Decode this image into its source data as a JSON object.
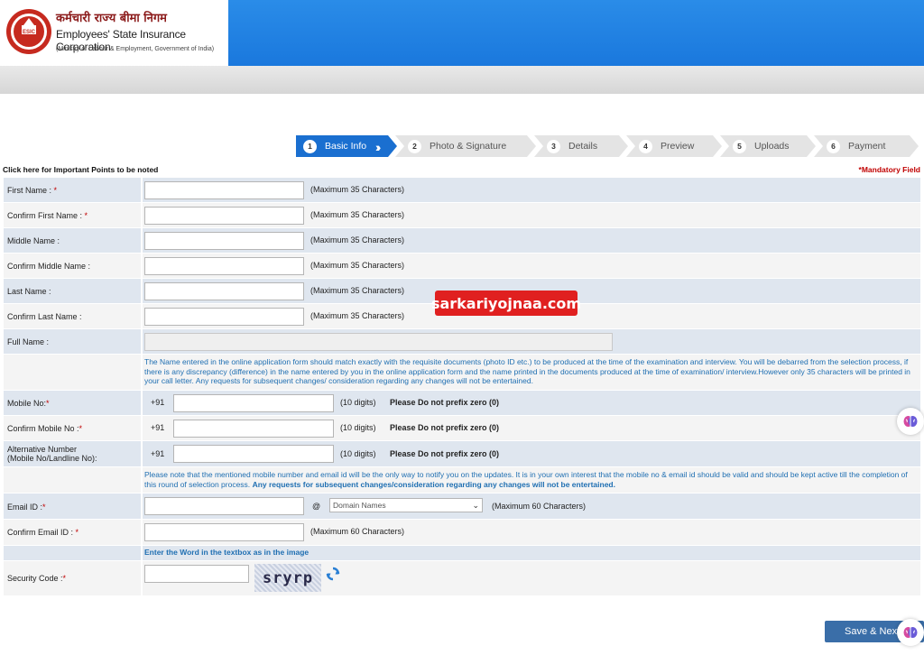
{
  "header": {
    "org_hindi": "कर्मचारी राज्य बीमा निगम",
    "org_english": "Employees' State Insurance Corporation",
    "org_sub": "(Ministry of Labour & Employment, Government of India)",
    "emblem_text": "ESIC"
  },
  "steps": [
    {
      "num": "1",
      "label": "Basic Info",
      "active": true
    },
    {
      "num": "2",
      "label": "Photo & Signature",
      "active": false
    },
    {
      "num": "3",
      "label": "Details",
      "active": false
    },
    {
      "num": "4",
      "label": "Preview",
      "active": false
    },
    {
      "num": "5",
      "label": "Uploads",
      "active": false
    },
    {
      "num": "6",
      "label": "Payment",
      "active": false
    }
  ],
  "important_link": "Click here for Important Points to be noted",
  "mandatory_text": "*Mandatory Field",
  "fields": {
    "first_name": {
      "label": "First Name :",
      "req": " *",
      "hint": "(Maximum 35 Characters)",
      "value": ""
    },
    "confirm_first_name": {
      "label": "Confirm First Name :",
      "req": " *",
      "hint": "(Maximum 35 Characters)",
      "value": ""
    },
    "middle_name": {
      "label": "Middle Name :",
      "hint": "(Maximum 35 Characters)",
      "value": ""
    },
    "confirm_middle_name": {
      "label": "Confirm Middle Name :",
      "hint": "(Maximum 35 Characters)",
      "value": ""
    },
    "last_name": {
      "label": "Last Name :",
      "hint": "(Maximum 35 Characters)",
      "value": ""
    },
    "confirm_last_name": {
      "label": "Confirm Last Name :",
      "hint": "(Maximum 35 Characters)",
      "value": ""
    },
    "full_name": {
      "label": "Full Name :",
      "value": ""
    },
    "mobile": {
      "label": "Mobile No:",
      "req": "*",
      "prefix": "+91",
      "hint": "(10 digits)",
      "hint2": "Please Do not prefix zero (0)",
      "value": ""
    },
    "confirm_mobile": {
      "label": "Confirm Mobile No :",
      "req": "*",
      "prefix": "+91",
      "hint": "(10 digits)",
      "hint2": "Please Do not prefix zero (0)",
      "value": ""
    },
    "alt_number": {
      "label_line1": "Alternative Number",
      "label_line2": "(Mobile No/Landline No):",
      "prefix": "+91",
      "hint": "(10 digits)",
      "hint2": "Please Do not prefix zero (0)",
      "value": ""
    },
    "email": {
      "label": "Email ID :",
      "req": "*",
      "at": "@",
      "domain_selected": "Domain Names",
      "hint": "(Maximum 60 Characters)",
      "value": ""
    },
    "confirm_email": {
      "label": "Confirm Email ID :",
      "req": " *",
      "hint": "(Maximum 60 Characters)",
      "value": ""
    },
    "security_code": {
      "label": "Security Code :",
      "req": "*",
      "value": "",
      "captcha_text": "sryrp"
    }
  },
  "notes": {
    "name_note": "The Name entered in the online application form should match exactly with the requisite documents (photo ID etc.) to be produced at the time of the examination and interview. You will be debarred from the selection process, if there is any discrepancy (difference) in the name entered by you in the online application form and the name printed in the documents produced at the time of examination/ interview.However only 35 characters will be printed in your call letter. Any requests for subsequent changes/ consideration regarding any changes will not be entertained.",
    "mobile_note": "Please note that the mentioned mobile number and email id will be the only way to notify you on the updates. It is in your own interest that the mobile no & email id should be valid and should be kept active till the completion of this round of selection process.",
    "mobile_note_bold": "Any requests for subsequent changes/consideration regarding any changes will not be entertained.",
    "captcha_instruction": "Enter the Word in the textbox as in the image"
  },
  "watermark": "sarkariyojnaa.com",
  "save_button": "Save & Next",
  "colors": {
    "header_blue": "#1a78dd",
    "active_step": "#1a6fd0",
    "inactive_step": "#e4e4e4",
    "row_shade": "#dfe6ef",
    "note_blue": "#1f6fb2",
    "required_red": "#c00000",
    "button_blue": "#3a6ea8"
  },
  "icons": {
    "refresh": "refresh-icon",
    "brain": "brain-icon"
  }
}
